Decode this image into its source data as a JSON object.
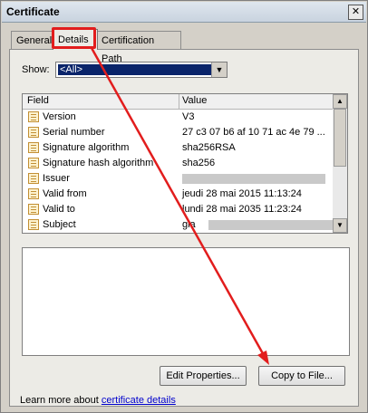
{
  "window": {
    "title": "Certificate",
    "close_glyph": "✕"
  },
  "tabs": [
    {
      "label": "General"
    },
    {
      "label": "Details"
    },
    {
      "label": "Certification Path"
    }
  ],
  "show": {
    "label": "Show:",
    "selected": "<All>"
  },
  "table": {
    "headers": {
      "field": "Field",
      "value": "Value"
    },
    "rows": [
      {
        "field": "Version",
        "value": "V3"
      },
      {
        "field": "Serial number",
        "value": "27 c3 07 b6 af 10 71 ac 4e 79 ..."
      },
      {
        "field": "Signature algorithm",
        "value": "sha256RSA"
      },
      {
        "field": "Signature hash algorithm",
        "value": "sha256"
      },
      {
        "field": "Issuer",
        "value": ""
      },
      {
        "field": "Valid from",
        "value": "jeudi 28 mai 2015 11:13:24"
      },
      {
        "field": "Valid to",
        "value": "lundi 28 mai 2035 11:23:24"
      },
      {
        "field": "Subject",
        "value": "gia"
      }
    ]
  },
  "buttons": {
    "edit_properties": "Edit Properties...",
    "copy_to_file": "Copy to File..."
  },
  "learn_more": {
    "prefix": "Learn more about ",
    "link": "certificate details"
  },
  "annotation": {
    "color": "#e21d1d"
  }
}
